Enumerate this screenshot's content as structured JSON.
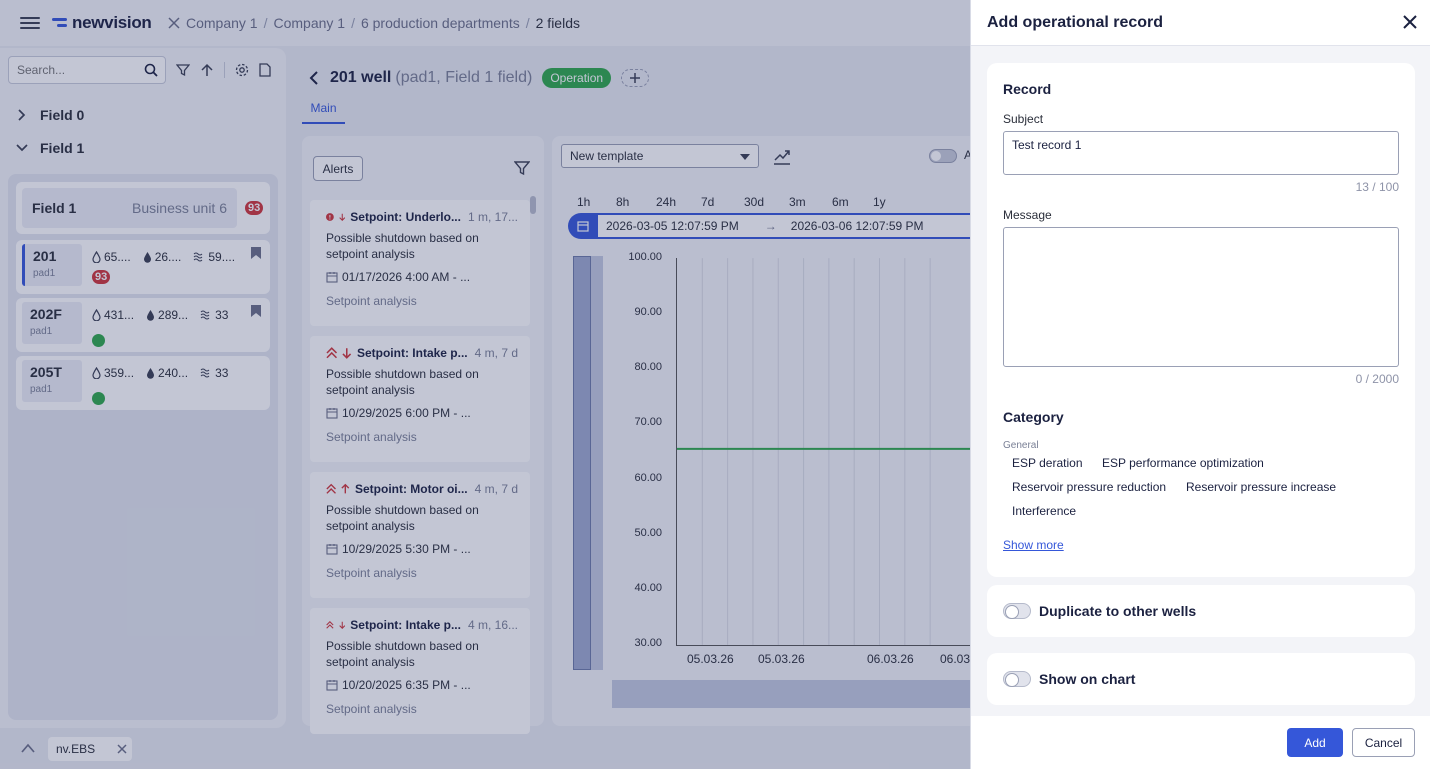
{
  "header": {
    "logo_text": "newvision",
    "breadcrumb": [
      "Company 1",
      "Company 1",
      "6 production departments",
      "2 fields"
    ]
  },
  "sidebar": {
    "search_placeholder": "Search...",
    "tree": [
      {
        "label": "Field 0",
        "expanded": false
      },
      {
        "label": "Field 1",
        "expanded": true
      }
    ],
    "field_group": {
      "title": "Field 1",
      "business_unit": "Business unit 6",
      "badge": "93"
    },
    "wells": [
      {
        "name": "201",
        "pad": "pad1",
        "m1": "65....",
        "m2": "26....",
        "m3": "59....",
        "badge": "93",
        "status_color": "#d0353a"
      },
      {
        "name": "202F",
        "pad": "pad1",
        "m1": "431...",
        "m2": "289...",
        "m3": "33",
        "status_color": "#2ea84a"
      },
      {
        "name": "205T",
        "pad": "pad1",
        "m1": "359...",
        "m2": "240...",
        "m3": "33",
        "status_color": "#2ea84a"
      }
    ]
  },
  "bottom_tab": {
    "label": "nv.EBS"
  },
  "main": {
    "well_title": "201 well",
    "well_subtitle": "(pad1, Field 1 field)",
    "status": "Operation",
    "tab": "Main",
    "alerts_button": "Alerts",
    "alerts": [
      {
        "title": "Setpoint: Underlo...",
        "time": "1 m, 17...",
        "message": "Possible shutdown based on setpoint analysis",
        "date": "01/17/2026 4:00 AM - ...",
        "source": "Setpoint analysis",
        "severity": "error",
        "direction": "down"
      },
      {
        "title": "Setpoint: Intake p...",
        "time": "4 m, 7 d",
        "message": "Possible shutdown based on setpoint analysis",
        "date": "10/29/2025 6:00 PM - ...",
        "source": "Setpoint analysis",
        "severity": "high",
        "direction": "down"
      },
      {
        "title": "Setpoint: Motor oi...",
        "time": "4 m, 7 d",
        "message": "Possible shutdown based on setpoint analysis",
        "date": "10/29/2025 5:30 PM - ...",
        "source": "Setpoint analysis",
        "severity": "high",
        "direction": "up"
      },
      {
        "title": "Setpoint: Intake p...",
        "time": "4 m, 16...",
        "message": "Possible shutdown based on setpoint analysis",
        "date": "10/20/2025 6:35 PM - ...",
        "source": "Setpoint analysis",
        "severity": "high",
        "direction": "down"
      }
    ],
    "template_select": "New template",
    "toggle_label": "A",
    "periods": [
      "1h",
      "8h",
      "24h",
      "7d",
      "30d",
      "3m",
      "6m",
      "1y"
    ],
    "range_start": "2026-03-05 12:07:59 PM",
    "range_arrow": "→",
    "range_end": "2026-03-06 12:07:59 PM"
  },
  "chart_data": {
    "type": "line",
    "y_ticks": [
      "100.00",
      "90.00",
      "80.00",
      "70.00",
      "60.00",
      "50.00",
      "40.00",
      "30.00"
    ],
    "x_ticks": [
      "05.03.26",
      "05.03.26",
      "06.03.26",
      "06.03"
    ],
    "ylim": [
      30,
      100
    ],
    "series": [
      {
        "values": [
          65.3,
          65.3
        ],
        "color": "#2ea84a"
      }
    ],
    "grid": true
  },
  "dialog": {
    "title": "Add operational record",
    "record_section": "Record",
    "subject_label": "Subject",
    "subject_value": "Test record 1",
    "subject_counter": "13 / 100",
    "message_label": "Message",
    "message_value": "",
    "message_counter": "0 / 2000",
    "category_title": "Category",
    "category_group": "General",
    "categories": [
      "ESP deration",
      "ESP performance optimization",
      "Reservoir pressure reduction",
      "Reservoir pressure increase",
      "Interference"
    ],
    "show_more": "Show more",
    "duplicate_label": "Duplicate to other wells",
    "show_on_chart_label": "Show on chart",
    "add_button": "Add",
    "cancel_button": "Cancel"
  },
  "colors": {
    "accent": "#3557d9",
    "success": "#2ea84a",
    "danger": "#d0353a"
  }
}
